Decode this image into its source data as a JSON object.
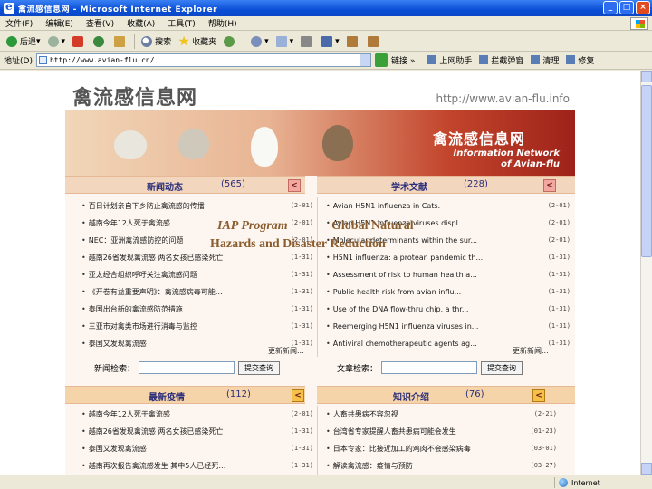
{
  "window": {
    "title": "禽流感信息网 - Microsoft Internet Explorer",
    "min": "_",
    "max": "□",
    "close": "×"
  },
  "menu": [
    "文件(F)",
    "编辑(E)",
    "查看(V)",
    "收藏(A)",
    "工具(T)",
    "帮助(H)"
  ],
  "toolbar": {
    "back": "后退",
    "search": "搜索",
    "favorites": "收藏夹"
  },
  "address": {
    "label": "地址(D)",
    "url": "http://www.avian-flu.cn/",
    "go": "",
    "links": "链接 »",
    "extra": [
      "上网助手",
      "拦截弹窗",
      "清理",
      "修复"
    ]
  },
  "site": {
    "logo": "禽流感信息网",
    "url": "http://www.avian-flu.info",
    "banner_title": "禽流感信息网",
    "banner_sub_1": "Information Network",
    "banner_sub_2": "of Avian-flu"
  },
  "news": {
    "title": "新闻动态",
    "count": "(565)",
    "btn": "<",
    "items": [
      {
        "text": "百日计划亲自下乡防止禽流感的传播",
        "date": "(2-01)"
      },
      {
        "text": "越南今年12人死于禽流感",
        "date": "(2-01)"
      },
      {
        "text": "NEC：亚洲禽流感防控的问题",
        "date": "(2-01)"
      },
      {
        "text": "越南26省发现禽流感 两名女孩已感染死亡",
        "date": "(1-31)"
      },
      {
        "text": "亚太经合组织呼吁关注禽流感问题",
        "date": "(1-31)"
      },
      {
        "text": "《开卷有益重要声明》：禽流感病毒可能…",
        "date": "(1-31)"
      },
      {
        "text": "泰国出台新的禽流感防范措施",
        "date": "(1-31)"
      },
      {
        "text": "三亚市对禽类市场进行消毒与监控",
        "date": "(1-31)"
      },
      {
        "text": "泰国又发现禽流感",
        "date": "(1-31)"
      }
    ],
    "more": "更新新闻..."
  },
  "papers": {
    "title": "学术文献",
    "count": "(228)",
    "btn": "<",
    "items": [
      {
        "text": "Avian H5N1 influenza in Cats.",
        "date": "(2-01)"
      },
      {
        "text": "Avian H5N1 influenza viruses displ...",
        "date": "(2-01)"
      },
      {
        "text": "Molecular determinants within the sur...",
        "date": "(2-01)"
      },
      {
        "text": "H5N1 influenza: a protean pandemic th...",
        "date": "(1-31)"
      },
      {
        "text": "Assessment of risk to human health a...",
        "date": "(1-31)"
      },
      {
        "text": "Public health risk from avian influ...",
        "date": "(1-31)"
      },
      {
        "text": "Use of the DNA flow-thru chip, a thr...",
        "date": "(1-31)"
      },
      {
        "text": "Reemerging H5N1 influenza viruses in...",
        "date": "(1-31)"
      },
      {
        "text": "Antiviral chemotherapeutic agents ag...",
        "date": "(1-31)"
      }
    ],
    "more": "更新新闻..."
  },
  "search_news": {
    "label": "新闻检索：",
    "btn": "提交查询"
  },
  "search_papers": {
    "label": "文章检索：",
    "btn": "提交查询"
  },
  "outbreaks": {
    "title": "最新疫情",
    "count": "(112)",
    "btn": "<",
    "items": [
      {
        "text": "越南今年12人死于禽流感",
        "date": "(2-01)"
      },
      {
        "text": "越南26省发现禽流感 两名女孩已感染死亡",
        "date": "(1-31)"
      },
      {
        "text": "泰国又发现禽流感",
        "date": "(1-31)"
      },
      {
        "text": "越南再次报告禽流感发生 其中5人已经死…",
        "date": "(1-31)"
      }
    ]
  },
  "knowledge": {
    "title": "知识介绍",
    "count": "(76)",
    "btn": "<",
    "items": [
      {
        "text": "人畜共患病不容忽视",
        "date": "(2-21)"
      },
      {
        "text": "台湾省专家提醒人畜共患病可能会发生",
        "date": "(01-23)"
      },
      {
        "text": "日本专家：比接近加工的鸡肉不会感染病毒",
        "date": "(03-01)"
      },
      {
        "text": "解读禽流感：疫情与预防",
        "date": "(03-27)"
      }
    ]
  },
  "status": {
    "zone": "Internet"
  },
  "overlays": {
    "line1": "IAP Program",
    "line2": "Global Natural",
    "line3": "Hazards and Disaster Reduction"
  }
}
